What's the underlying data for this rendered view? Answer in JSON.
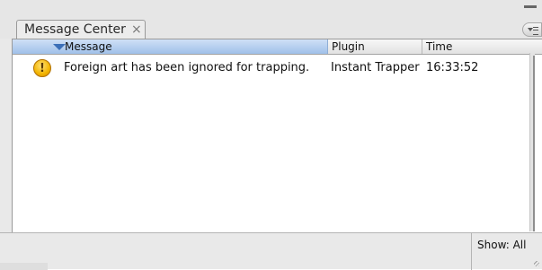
{
  "panel": {
    "tab_title": "Message Center",
    "tab_close": "×"
  },
  "table": {
    "columns": [
      "Message",
      "Plugin",
      "Time"
    ],
    "rows": [
      {
        "icon": "warning-icon",
        "icon_glyph": "!",
        "message": "Foreign art has been ignored for trapping.",
        "plugin": "Instant Trapper",
        "time": "16:33:52"
      }
    ]
  },
  "footer": {
    "show_label": "Show: All"
  }
}
